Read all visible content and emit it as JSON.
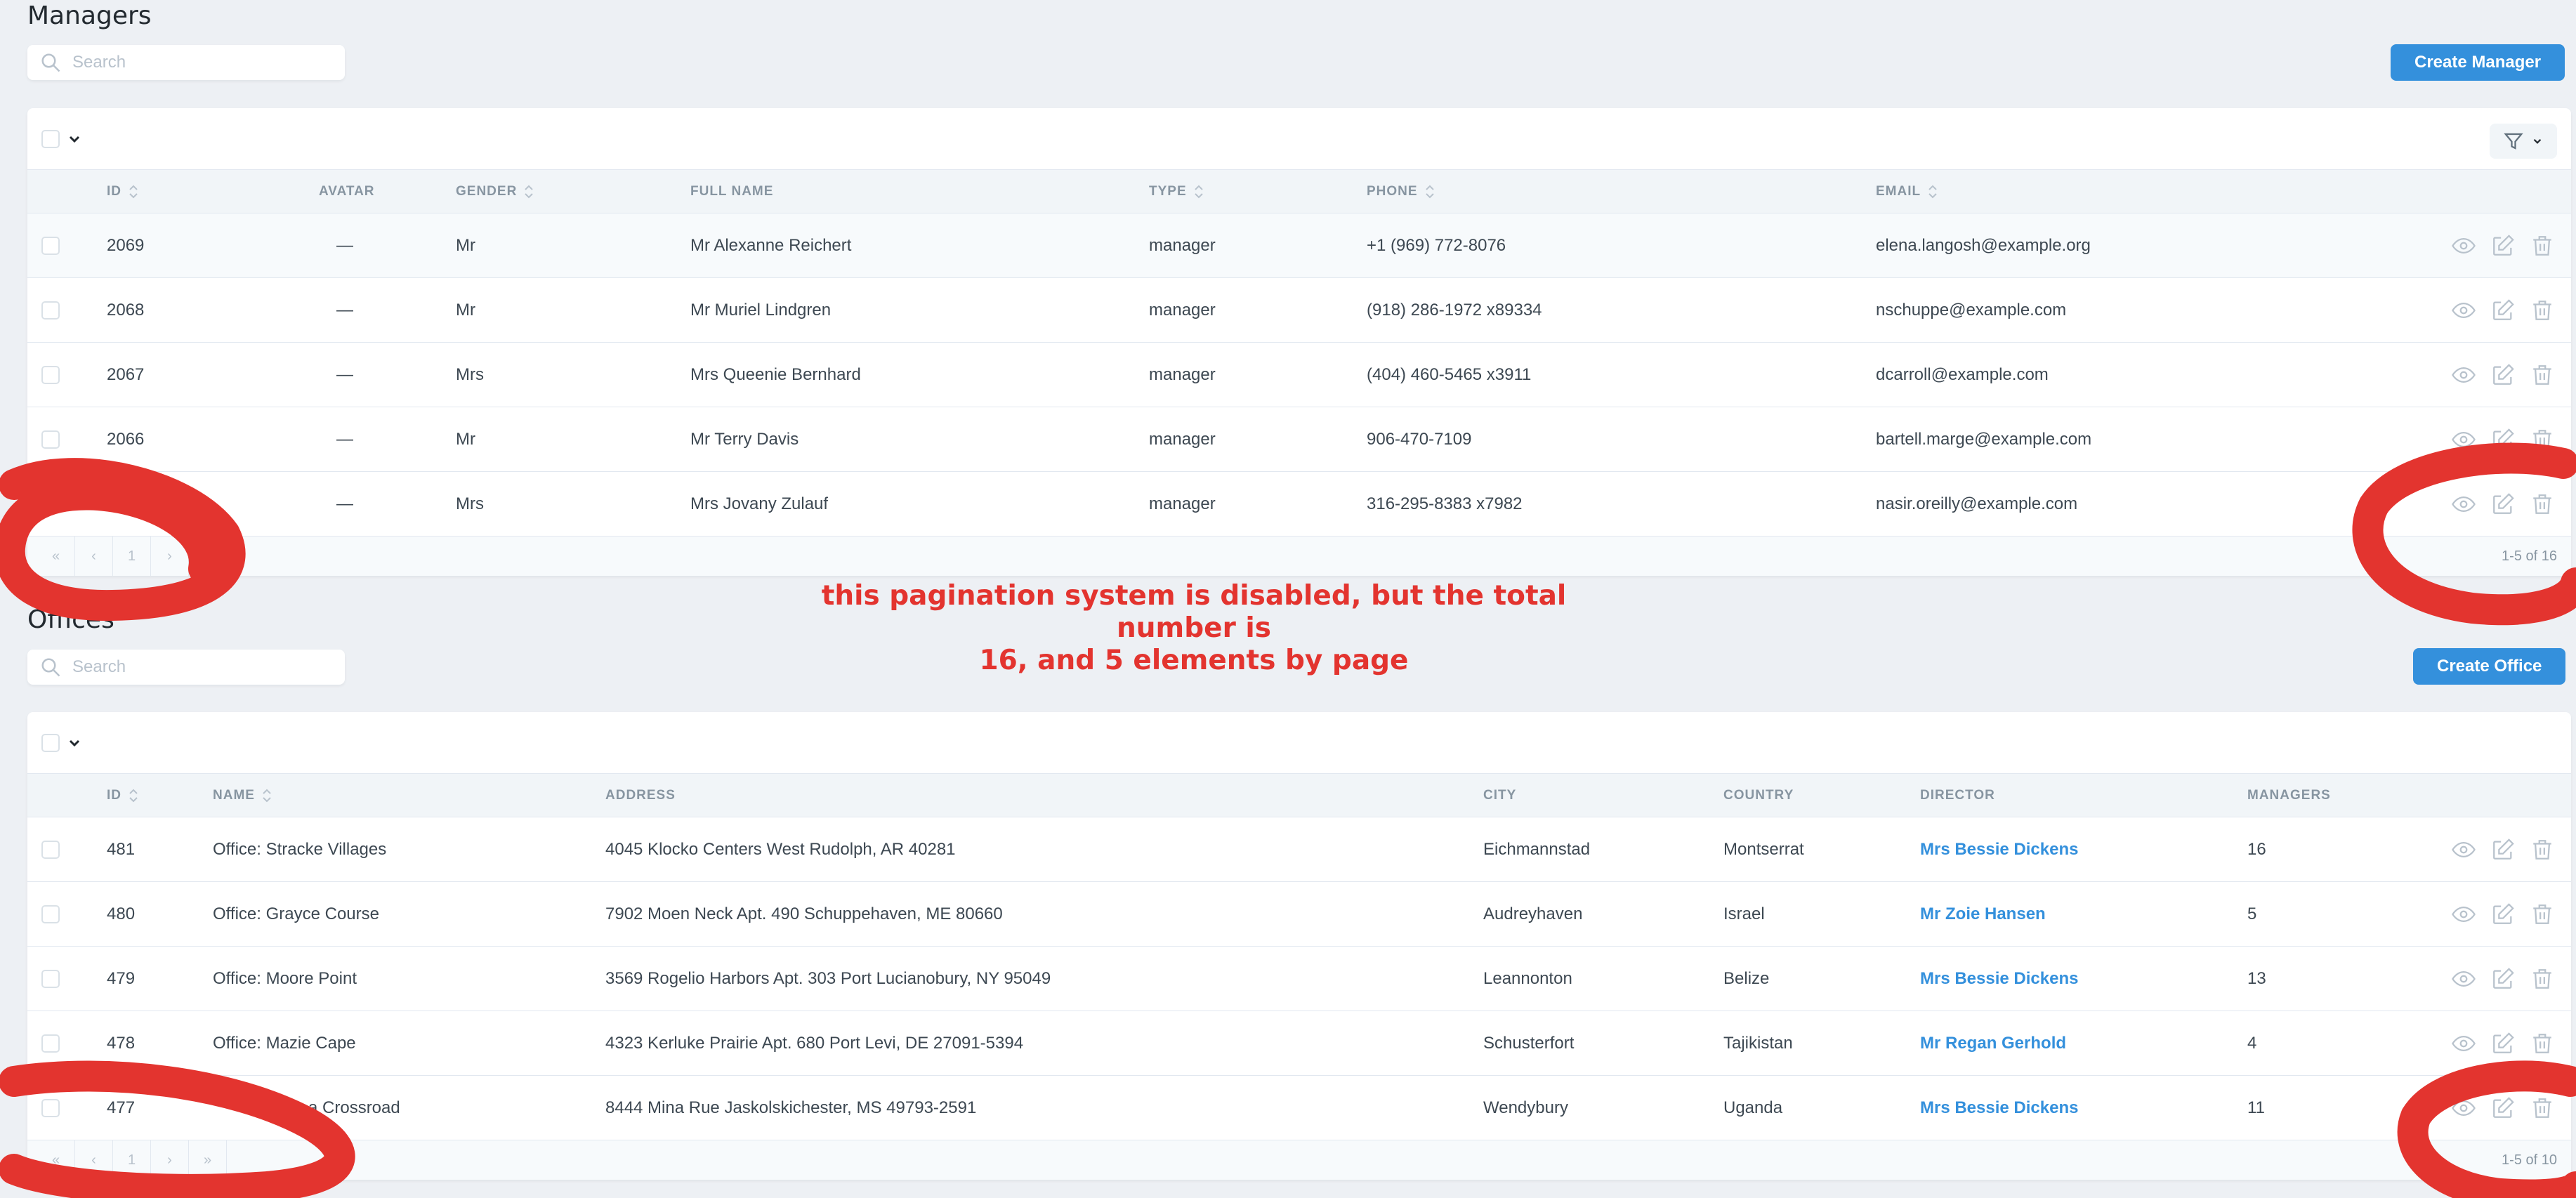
{
  "managers": {
    "title": "Managers",
    "search_placeholder": "Search",
    "create_label": "Create Manager",
    "columns": [
      "ID",
      "AVATAR",
      "GENDER",
      "FULL NAME",
      "TYPE",
      "PHONE",
      "EMAIL"
    ],
    "rows": [
      {
        "id": "2069",
        "avatar": "—",
        "gender": "Mr",
        "full_name": "Mr Alexanne Reichert",
        "type": "manager",
        "phone": "+1 (969) 772-8076",
        "email": "elena.langosh@example.org"
      },
      {
        "id": "2068",
        "avatar": "—",
        "gender": "Mr",
        "full_name": "Mr Muriel Lindgren",
        "type": "manager",
        "phone": "(918) 286-1972 x89334",
        "email": "nschuppe@example.com"
      },
      {
        "id": "2067",
        "avatar": "—",
        "gender": "Mrs",
        "full_name": "Mrs Queenie Bernhard",
        "type": "manager",
        "phone": "(404) 460-5465 x3911",
        "email": "dcarroll@example.com"
      },
      {
        "id": "2066",
        "avatar": "—",
        "gender": "Mr",
        "full_name": "Mr Terry Davis",
        "type": "manager",
        "phone": "906-470-7109",
        "email": "bartell.marge@example.com"
      },
      {
        "id": "",
        "avatar": "—",
        "gender": "Mrs",
        "full_name": "Mrs Jovany Zulauf",
        "type": "manager",
        "phone": "316-295-8383 x7982",
        "email": "nasir.oreilly@example.com"
      }
    ],
    "pager": {
      "first": "«",
      "prev": "‹",
      "page": "1",
      "next": "›",
      "last": "»"
    },
    "pagination_info": "1-5 of 16"
  },
  "offices": {
    "title": "Offices",
    "search_placeholder": "Search",
    "create_label": "Create Office",
    "columns": [
      "ID",
      "NAME",
      "ADDRESS",
      "CITY",
      "COUNTRY",
      "DIRECTOR",
      "MANAGERS"
    ],
    "rows": [
      {
        "id": "481",
        "name": "Office: Stracke Villages",
        "address": "4045 Klocko Centers West Rudolph, AR 40281",
        "city": "Eichmannstad",
        "country": "Montserrat",
        "director": "Mrs Bessie Dickens",
        "managers": "16"
      },
      {
        "id": "480",
        "name": "Office: Grayce Course",
        "address": "7902 Moen Neck Apt. 490 Schuppehaven, ME 80660",
        "city": "Audreyhaven",
        "country": "Israel",
        "director": "Mr Zoie Hansen",
        "managers": "5"
      },
      {
        "id": "479",
        "name": "Office: Moore Point",
        "address": "3569 Rogelio Harbors Apt. 303 Port Lucianobury, NY 95049",
        "city": "Leannonton",
        "country": "Belize",
        "director": "Mrs Bessie Dickens",
        "managers": "13"
      },
      {
        "id": "478",
        "name": "Office: Mazie Cape",
        "address": "4323 Kerluke Prairie Apt. 680 Port Levi, DE 27091-5394",
        "city": "Schusterfort",
        "country": "Tajikistan",
        "director": "Mr Regan Gerhold",
        "managers": "4"
      },
      {
        "id": "477",
        "name": "a Crossroad",
        "address": "8444 Mina Rue Jaskolskichester, MS 49793-2591",
        "city": "Wendybury",
        "country": "Uganda",
        "director": "Mrs Bessie Dickens",
        "managers": "11"
      }
    ],
    "pager": {
      "first": "«",
      "prev": "‹",
      "page": "1",
      "next": "›",
      "last": "»"
    },
    "pagination_info": "1-5 of 10"
  },
  "annotation": {
    "line1": "this pagination system is disabled, but the total number is",
    "line2": "16, and  5 elements by page",
    "color": "#e3342f"
  },
  "icons": [
    "search-icon",
    "chevron-down-icon",
    "filter-icon",
    "sort-icon",
    "eye-icon",
    "edit-icon",
    "trash-icon"
  ],
  "colors": {
    "accent": "#3490dc",
    "background": "#edf0f4",
    "annotation": "#e3342f"
  }
}
